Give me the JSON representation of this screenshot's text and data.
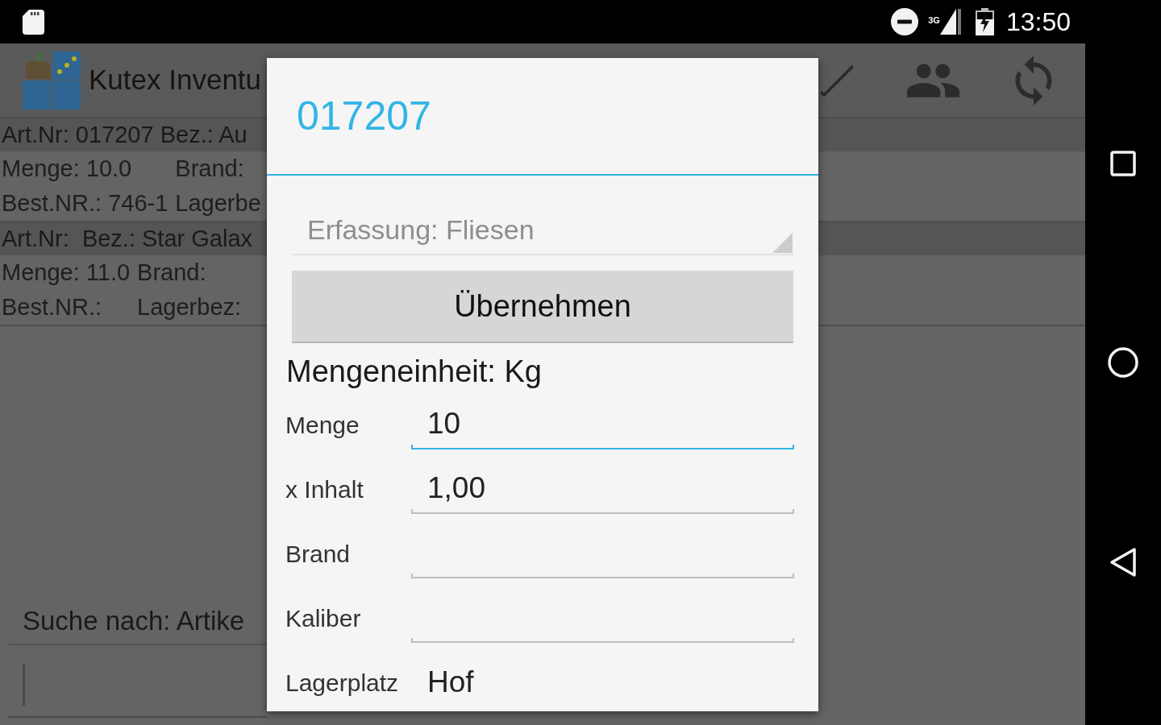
{
  "status_bar": {
    "network": "3G",
    "time": "13:50"
  },
  "app_bar": {
    "title": "Kutex Inventu"
  },
  "list": [
    {
      "header": "Art.Nr: 017207 Bez.: Au",
      "cells": [
        "Menge: 10.0",
        "Brand:",
        "Best.NR.: 746-1",
        "Lagerbe"
      ]
    },
    {
      "header": "Art.Nr:  Bez.: Star Galax",
      "cells": [
        "Menge: 11.0",
        "Brand:",
        "Best.NR.:",
        "Lagerbez:"
      ]
    }
  ],
  "search": {
    "label": "Suche nach: Artike"
  },
  "dialog": {
    "title": "017207",
    "dropdown": {
      "value": "Erfassung: Fliesen",
      "disabled": true
    },
    "button": "Übernehmen",
    "unit": "Mengeneinheit: Kg",
    "fields": [
      {
        "kind": "input",
        "label": "Menge",
        "value": "10",
        "focused": true
      },
      {
        "kind": "input",
        "label": "x Inhalt",
        "value": "1,00",
        "focused": false
      },
      {
        "kind": "input",
        "label": "Brand",
        "focused": false
      },
      {
        "kind": "input",
        "label": "Kaliber",
        "focused": false
      },
      {
        "kind": "text",
        "label": "Lagerplatz",
        "value": "Hof"
      }
    ]
  }
}
